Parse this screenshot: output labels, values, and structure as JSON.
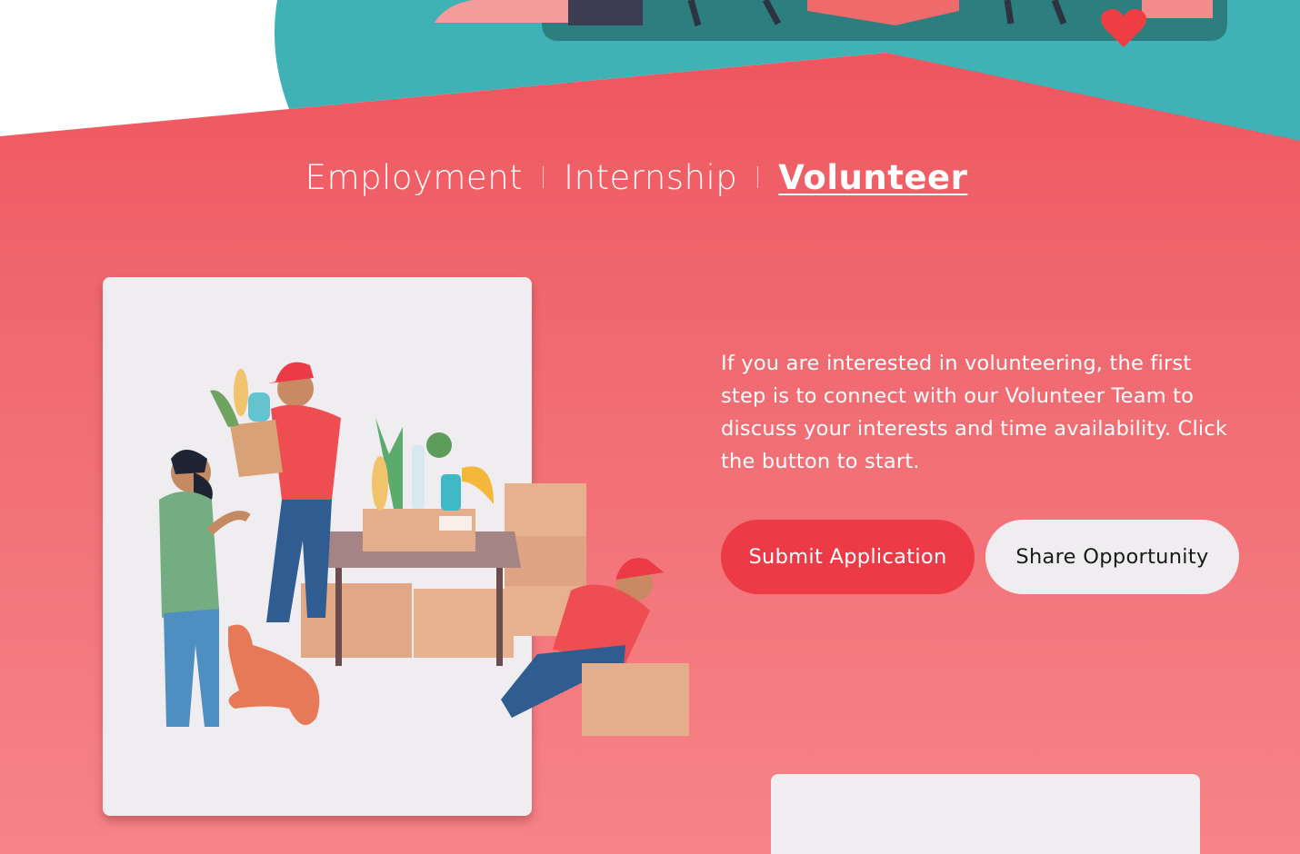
{
  "tabs": [
    {
      "label": "Employment",
      "active": false
    },
    {
      "label": "Internship",
      "active": false
    },
    {
      "label": "Volunteer",
      "active": true
    }
  ],
  "volunteer": {
    "description": "If you are interested in volunteering, the first step is to connect with our Volunteer Team to discuss your interests and time availability. Click the button to start.",
    "primary_button": "Submit Application",
    "secondary_button": "Share Opportunity"
  },
  "colors": {
    "brand_red": "#ef525c",
    "button_red": "#ec3a47",
    "teal": "#40b1b4",
    "card_bg": "#efedef"
  },
  "illustration": {
    "icon": "volunteers-food-donation-illustration"
  }
}
